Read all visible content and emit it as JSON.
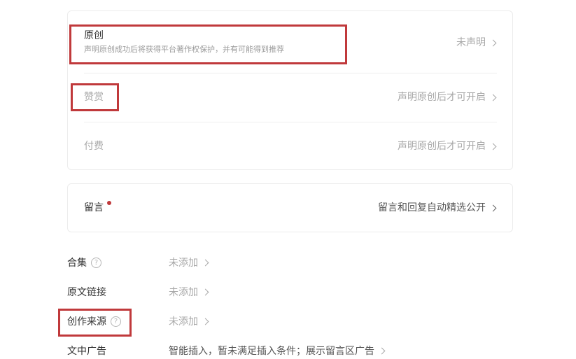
{
  "settings_card": {
    "original": {
      "title": "原创",
      "description": "声明原创成功后将获得平台著作权保护，并有可能得到推荐",
      "value": "未声明"
    },
    "reward": {
      "title": "赞赏",
      "value": "声明原创后才可开启"
    },
    "paid": {
      "title": "付费",
      "value": "声明原创后才可开启"
    }
  },
  "comment_card": {
    "title": "留言",
    "value": "留言和回复自动精选公开"
  },
  "list": {
    "collection": {
      "label": "合集",
      "value": "未添加",
      "help": "?"
    },
    "source_link": {
      "label": "原文链接",
      "value": "未添加"
    },
    "creation_source": {
      "label": "创作来源",
      "value": "未添加",
      "help": "?"
    },
    "in_article_ad": {
      "label": "文中广告",
      "value": "智能插入，暂未满足插入条件；展示留言区广告"
    }
  },
  "colors": {
    "highlight_box": "#c0393b",
    "notification_dot": "#c0393b",
    "muted_text": "#a8a8a8",
    "primary_text": "#333333"
  }
}
